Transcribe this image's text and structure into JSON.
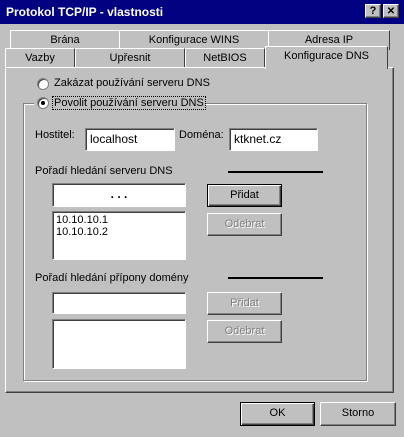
{
  "window": {
    "title": "Protokol TCP/IP - vlastnosti",
    "help_label": "?",
    "close_label": "✕"
  },
  "tabs_back": [
    {
      "label": "Brána"
    },
    {
      "label": "Konfigurace WINS"
    },
    {
      "label": "Adresa IP"
    }
  ],
  "tabs_front": [
    {
      "label": "Vazby"
    },
    {
      "label": "Upřesnit"
    },
    {
      "label": "NetBIOS"
    },
    {
      "label": "Konfigurace DNS"
    }
  ],
  "dns": {
    "disable_label": "Zakázat používání serveru DNS",
    "enable_label": "Povolit používání serveru DNS",
    "selected": "enable",
    "host_label": "Hostitel:",
    "host_value": "localhost",
    "domain_label": "Doména:",
    "domain_value": "ktknet.cz",
    "server_order_label": "Pořadí hledání serveru DNS",
    "ip_input_dots": ".        .        .",
    "servers": [
      "10.10.10.1",
      "10.10.10.2"
    ],
    "add_label": "Přidat",
    "remove_label": "Odebrat",
    "suffix_order_label": "Pořadí hledání přípony domény",
    "suffix_value": "",
    "suffix_add_label": "Přidat",
    "suffix_remove_label": "Odebrat"
  },
  "footer": {
    "ok_label": "OK",
    "cancel_label": "Storno"
  }
}
